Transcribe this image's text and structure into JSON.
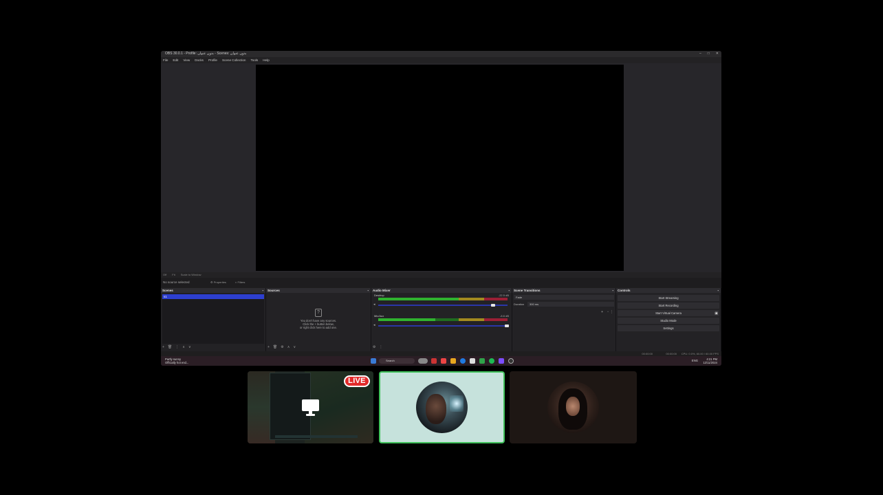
{
  "obs": {
    "title": "OBS 30.0.1 - Profile: بدون عنوان - Scenes: بدون عنوان",
    "window_controls": [
      "–",
      "□",
      "✕"
    ],
    "menu": [
      "File",
      "Edit",
      "View",
      "Docks",
      "Profile",
      "Scene Collection",
      "Tools",
      "Help"
    ],
    "scene_strip": [
      "Off",
      "Fit",
      "Scale to Window"
    ],
    "context_bar": {
      "label": "No source selected",
      "properties": "Properties",
      "filters": "Filters"
    },
    "docks": {
      "scenes": {
        "title": "Scenes",
        "items": [
          "s1"
        ],
        "footer": [
          "+",
          "🗑",
          "⋮",
          "∧",
          "∨"
        ]
      },
      "sources": {
        "title": "Sources",
        "empty_line1": "You don't have any sources.",
        "empty_line2": "Click the + button below,",
        "empty_line3": "or right click here to add one.",
        "footer": [
          "+",
          "🗑",
          "⚙",
          "∧",
          "∨"
        ]
      },
      "audio_mixer": {
        "title": "Audio Mixer",
        "channels": [
          {
            "name": "Desktop",
            "db": "-22.5 dB",
            "level": 0.62
          },
          {
            "name": "Mic/Aux",
            "db": "-8.6 dB",
            "level": 0.44
          }
        ],
        "footer": [
          "⚙",
          "⋮"
        ]
      },
      "transitions": {
        "title": "Scene Transitions",
        "type": "Fade",
        "duration_label": "Duration",
        "duration_value": "300 ms"
      },
      "controls": {
        "title": "Controls",
        "buttons": [
          "Start Streaming",
          "Start Recording",
          "Start Virtual Camera",
          "Studio Mode",
          "Settings"
        ]
      }
    },
    "status": {
      "rec": "00:00:00",
      "stream": "00:00:00",
      "cpu": "CPU: 0.0%, 60.00 / 60.00 FPS"
    }
  },
  "taskbar": {
    "weather_temp": "Partly sunny",
    "weather_desc": "Officially hot end...",
    "search_placeholder": "Search",
    "tray": "ENG",
    "time": "4:21 PM",
    "date": "12/11/2024"
  },
  "call": {
    "live_label": "LIVE"
  },
  "colors": {
    "active_speaker_border": "#3fc15a",
    "live_badge": "#e32b2b",
    "scene_selection": "#2d3fcf"
  }
}
